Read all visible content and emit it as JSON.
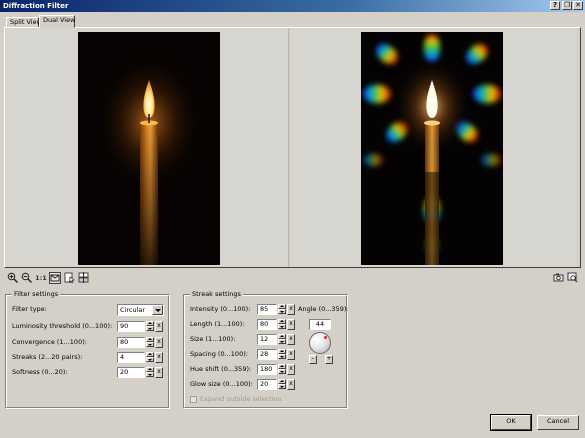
{
  "window": {
    "title": "Diffraction Filter"
  },
  "title_buttons": {
    "help": "?",
    "restore": "❐",
    "close": "✕"
  },
  "tabs": [
    "Split View",
    "Dual View"
  ],
  "active_tab": "Dual View",
  "toolbar": {
    "zoom_in": "zoom-in-icon",
    "zoom_out": "zoom-out-icon",
    "actual_size": "1:1",
    "fit": "fit-window-icon",
    "pan": "pan-icon",
    "compare": "compare-icon",
    "preview_right_1": "camera-icon",
    "preview_right_2": "zoom-preview-icon"
  },
  "filter_settings": {
    "title": "Filter settings",
    "filter_type_label": "Filter type:",
    "filter_type_value": "Circular",
    "rows": [
      {
        "label": "Luminosity threshold (0...100):",
        "value": "90"
      },
      {
        "label": "Convergence (1...100):",
        "value": "80"
      },
      {
        "label": "Streaks (2...20 pairs):",
        "value": "4"
      },
      {
        "label": "Softness (0...20):",
        "value": "20"
      }
    ]
  },
  "streak_settings": {
    "title": "Streak settings",
    "rows": [
      {
        "label": "Intensity (0...100):",
        "value": "85"
      },
      {
        "label": "Length (1...100):",
        "value": "80"
      },
      {
        "label": "Size (1...100):",
        "value": "12"
      },
      {
        "label": "Spacing (0...100):",
        "value": "28"
      },
      {
        "label": "Hue shift (0...359):",
        "value": "180"
      },
      {
        "label": "Glow size (0...100):",
        "value": "20"
      }
    ],
    "angle_label": "Angle (0...359):",
    "angle_value": "44",
    "angle_minus": "-",
    "angle_plus": "+",
    "expand_label": "Expand outside selection",
    "expand_checked": false
  },
  "spin_clear": "x",
  "buttons": {
    "ok": "OK",
    "cancel": "Cancel"
  }
}
